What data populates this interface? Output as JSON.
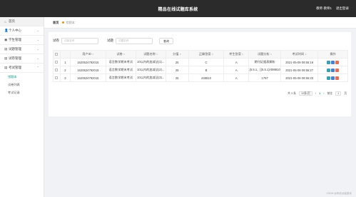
{
  "header": {
    "title": "精品在线试题库系统",
    "user_label": "教师 教师1",
    "logout_label": "退出登录"
  },
  "sidebar": {
    "items": [
      {
        "icon": "home-icon",
        "glyph": "⌂",
        "label": "首页",
        "arrow": ""
      },
      {
        "icon": "user-icon",
        "glyph": "👤",
        "label": "个人中心",
        "arrow": "⌄"
      },
      {
        "icon": "student-icon",
        "glyph": "▣",
        "label": "学生管理",
        "arrow": "⌄"
      },
      {
        "icon": "exam-icon",
        "glyph": "▤",
        "label": "试题管理",
        "arrow": "⌄"
      },
      {
        "icon": "paper-icon",
        "glyph": "▤",
        "label": "试卷管理",
        "arrow": "⌄"
      },
      {
        "icon": "test-icon",
        "glyph": "▤",
        "label": "考试管理",
        "arrow": "⌃"
      }
    ],
    "subitems": [
      "错题本",
      "试卷列表",
      "考试记录"
    ]
  },
  "tabs": [
    {
      "label": "首页"
    },
    {
      "label": "错题本"
    }
  ],
  "search": {
    "label1": "试卷",
    "placeholder1": "试卷名称",
    "label2": "试题",
    "placeholder2": "试题名称",
    "button": "查询"
  },
  "table": {
    "headers": [
      "用户ID",
      "试卷",
      "试题名称",
      "分值",
      "正确答案",
      "考生答案",
      "试题分析",
      "考试时间",
      "操作"
    ],
    "rows": [
      [
        "1620524792015",
        "语言数学期末考试",
        "10以内的加减法(1)...",
        "25",
        "C",
        "A",
        "期刊证据表解析",
        "2021-05-09 09:55:16"
      ],
      [
        "1620524792015",
        "语言数学期末考试",
        "10以内的加减法(2)...",
        "25",
        "B",
        "A",
        "(5.5.1、[(5.5.1)/498810",
        "2021-05-09 09:55:27"
      ],
      [
        "1620524792015",
        "语言数学期末考试",
        "10以内的加减法(3)...",
        "25",
        "448810",
        "A",
        "1797",
        "2021-05-09 09:55:33"
      ]
    ]
  },
  "pager": {
    "total": "共 3 条",
    "page_size": "10条/页",
    "prev": "‹",
    "current": "1",
    "next": "›",
    "goto_label": "前往",
    "goto_value": "1",
    "page_suffix": "页"
  },
  "watermark": "CSDN @码农@高粱米"
}
